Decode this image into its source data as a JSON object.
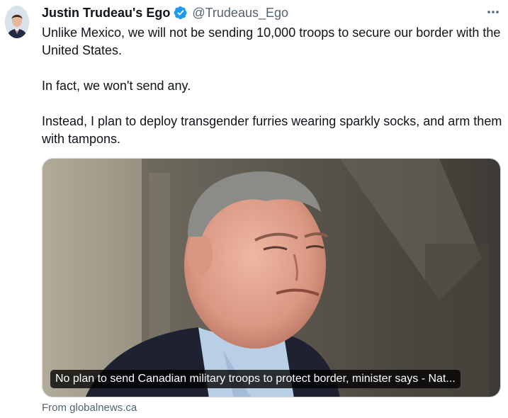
{
  "author": {
    "name": "Justin Trudeau's Ego",
    "handle": "@Trudeaus_Ego",
    "verified": true,
    "avatar_icon": "profile-photo"
  },
  "tweet": {
    "paragraphs": [
      "Unlike Mexico, we will not be sending 10,000 troops to secure our border with the United States.",
      "In fact, we won't send any.",
      "Instead, I plan to deploy transgender furries wearing sparkly socks, and arm them with tampons."
    ]
  },
  "link_card": {
    "headline": "No plan to send Canadian military troops to protect border, minister says - Nat...",
    "source": "From globalnews.ca"
  },
  "colors": {
    "verified_blue": "#1d9bf0",
    "secondary_text": "#536471",
    "primary_text": "#0f1419"
  },
  "icons": {
    "verified": "verified-badge-icon",
    "more": "more-options-icon"
  }
}
